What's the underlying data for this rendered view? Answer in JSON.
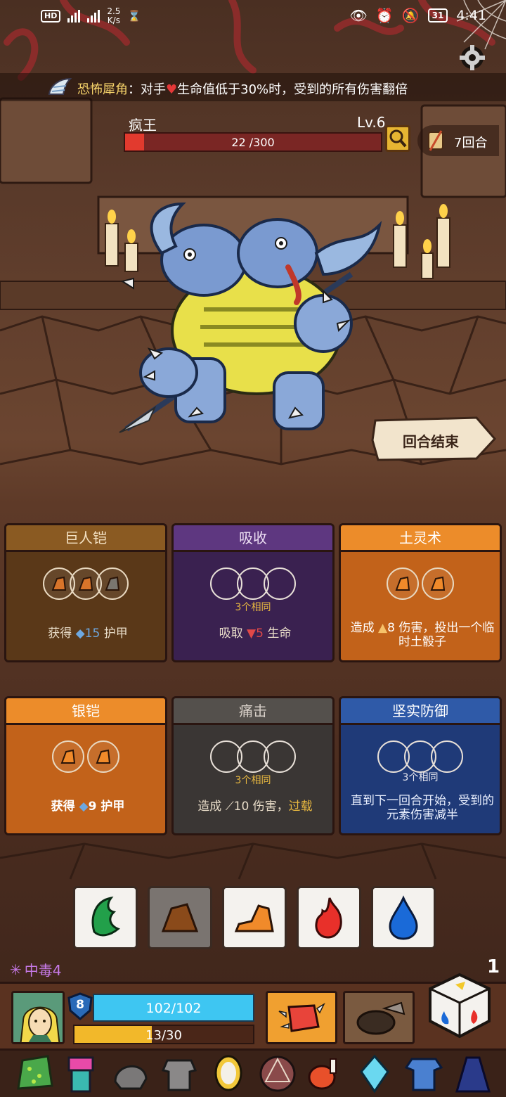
{
  "status_bar": {
    "net_speed_value": "2.5",
    "net_speed_unit": "K/s",
    "battery": "31",
    "time": "4:41",
    "sim1": "4G",
    "sim2": "4G"
  },
  "modifier": {
    "name": "恐怖犀角",
    "prefix": "：对手",
    "text": "生命值低于30%时，受到的所有伤害翻倍",
    "icon": "horn-icon"
  },
  "enemy": {
    "name": "疯王",
    "level": "Lv.6",
    "hp_text": "22 /300",
    "hp_fraction": 0.073
  },
  "turns_label": "7回合",
  "end_turn_label": "回合结束",
  "cards": [
    {
      "title": "巨人铠",
      "slots": [
        "earth",
        "earth",
        "earth-gray"
      ],
      "same": "",
      "desc_pre": "获得",
      "desc_num": "15",
      "desc_post": "护甲",
      "color": "brown"
    },
    {
      "title": "吸收",
      "slots": [
        "empty",
        "empty",
        "empty"
      ],
      "same": "3个相同",
      "desc_pre": "吸取",
      "desc_num": "5",
      "desc_post": "生命",
      "color": "purple"
    },
    {
      "title": "土灵术",
      "slots": [
        "earth",
        "earth"
      ],
      "same": "",
      "desc_pre": "造成",
      "desc_num": "8",
      "desc_post": "伤害，投出一个临时土骰子",
      "color": "orange"
    },
    {
      "title": "银铠",
      "slots": [
        "earth",
        "earth"
      ],
      "same": "",
      "desc_pre": "获得",
      "desc_num": "9",
      "desc_post": "护甲",
      "color": "orange"
    },
    {
      "title": "痛击",
      "slots": [
        "empty",
        "empty",
        "empty"
      ],
      "same": "3个相同",
      "desc_pre": "造成",
      "desc_num": "10",
      "desc_post": "伤害，",
      "desc_extra": "过载",
      "color": "gray"
    },
    {
      "title": "坚实防御",
      "slots": [
        "empty",
        "empty",
        "empty"
      ],
      "same": "3个相同",
      "desc_pre": "",
      "desc_num": "",
      "desc_post": "直到下一回合开始，受到的元素伤害减半",
      "color": "blue"
    }
  ],
  "dice": [
    {
      "name": "leaf-die-icon",
      "selected": false
    },
    {
      "name": "earth-die-icon",
      "selected": true
    },
    {
      "name": "earth-die-icon",
      "selected": false
    },
    {
      "name": "fire-die-icon",
      "selected": false
    },
    {
      "name": "water-die-icon",
      "selected": false
    }
  ],
  "status_effects": {
    "poison_label": "中毒4",
    "counter": "1"
  },
  "player": {
    "level": "8",
    "hp_text": "102/102",
    "xp_text": "13/30",
    "xp_fraction": 0.433
  },
  "colors": {
    "enemy_hp": "#e23a2e",
    "player_hp": "#3ec6f2",
    "player_xp": "#f2b82a",
    "poison": "#c77ae8",
    "armor": "#6ea8e0"
  }
}
